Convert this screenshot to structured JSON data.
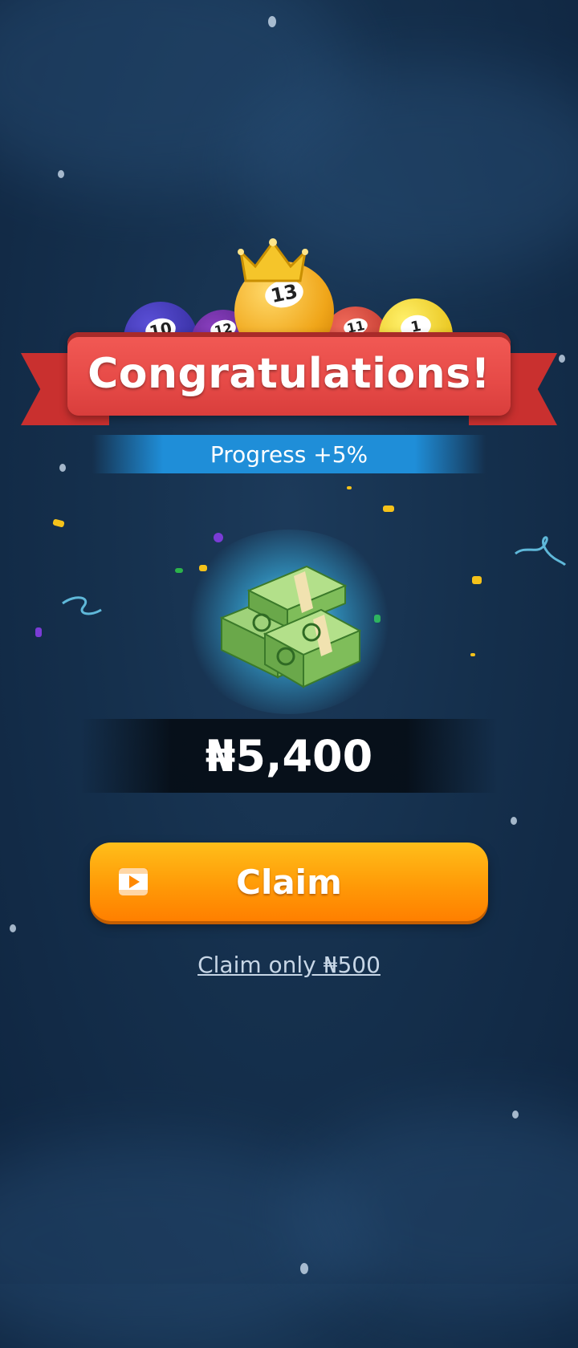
{
  "banner": {
    "title": "Congratulations!"
  },
  "progress": {
    "label": "Progress +5%"
  },
  "reward": {
    "amount": "₦5,400"
  },
  "actions": {
    "claim_label": "Claim",
    "claim_alt_label": "Claim only ₦500"
  },
  "balls": [
    "10",
    "12",
    "13",
    "11",
    "1"
  ],
  "colors": {
    "ribbon": "#e64a47",
    "progress_band": "#1f8ed8",
    "claim_button": "#ff9a07"
  },
  "icons": {
    "claim_icon": "video-icon",
    "reward_icon": "cash-stack-icon",
    "crown": "crown-icon"
  }
}
